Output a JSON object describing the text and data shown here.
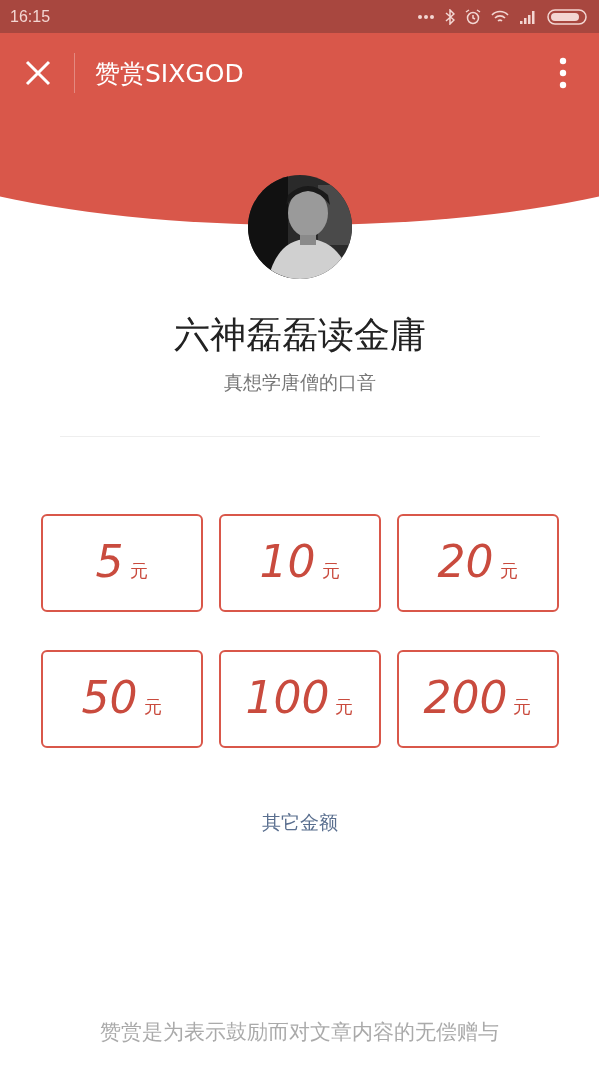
{
  "status_bar": {
    "time": "16:15"
  },
  "nav": {
    "title": "赞赏SIXGOD"
  },
  "profile": {
    "name": "六神磊磊读金庸",
    "subtitle": "真想学唐僧的口音"
  },
  "amounts": [
    {
      "value": "5",
      "unit": "元"
    },
    {
      "value": "10",
      "unit": "元"
    },
    {
      "value": "20",
      "unit": "元"
    },
    {
      "value": "50",
      "unit": "元"
    },
    {
      "value": "100",
      "unit": "元"
    },
    {
      "value": "200",
      "unit": "元"
    }
  ],
  "other_amount": "其它金额",
  "footer_note": "赞赏是为表示鼓励而对文章内容的无偿赠与"
}
